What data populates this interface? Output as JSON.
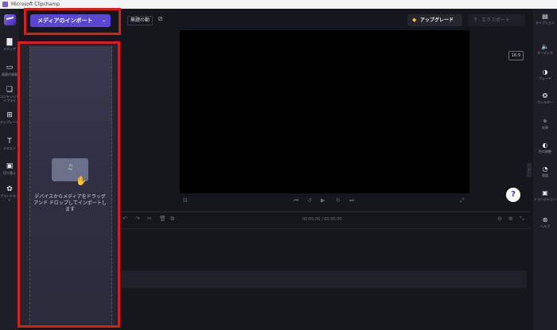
{
  "window": {
    "title": "Microsoft Clipchamp"
  },
  "toolbar": {
    "import_label": "メディアのインポート",
    "project_name": "無題の動",
    "upgrade_label": "アップグレード",
    "export_label": "エクスポート"
  },
  "left_rail": {
    "items": [
      {
        "label": "メディア",
        "icon": "folder-icon"
      },
      {
        "label": "画面の録画",
        "icon": "camera-icon"
      },
      {
        "label": "コンテンツライブラリ",
        "icon": "library-icon"
      },
      {
        "label": "テンプレート",
        "icon": "template-icon"
      },
      {
        "label": "テキスト",
        "icon": "text-icon"
      },
      {
        "label": "切り替え",
        "icon": "transitions-icon"
      },
      {
        "label": "ブランドキット",
        "icon": "brand-kit-icon"
      }
    ]
  },
  "media_panel": {
    "drop_hint": "デバイスからメディアをドラッグ アンド ドロップしてインポートします"
  },
  "preview": {
    "aspect_ratio": "16:9",
    "background": "#000000"
  },
  "timeline": {
    "timecode": "00:00.00 / 00:00.00"
  },
  "right_rail": {
    "items": [
      {
        "label": "キャプション",
        "icon": "captions-icon"
      },
      {
        "label": "オーディオ",
        "icon": "audio-icon"
      },
      {
        "label": "フェード",
        "icon": "fade-icon"
      },
      {
        "label": "フィルター",
        "icon": "filter-icon"
      },
      {
        "label": "効果",
        "icon": "effects-icon"
      },
      {
        "label": "色の調整",
        "icon": "color-adjust-icon"
      },
      {
        "label": "速度",
        "icon": "speed-icon"
      },
      {
        "label": "トランジション",
        "icon": "transition-icon"
      },
      {
        "label": "ヘルプ",
        "icon": "help-circle-icon"
      }
    ]
  },
  "colors": {
    "accent": "#5a45d4",
    "highlight": "#d81f1f",
    "background": "#16161d"
  }
}
